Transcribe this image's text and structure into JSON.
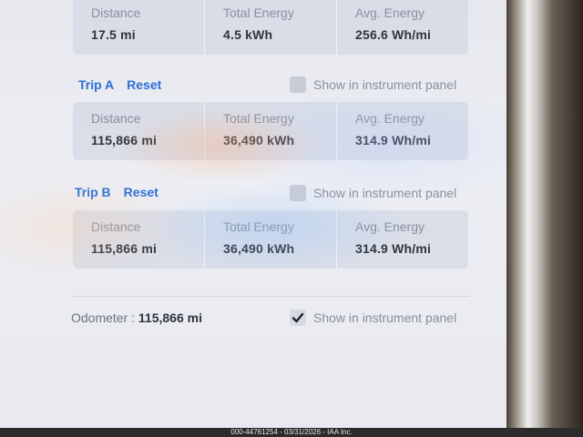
{
  "top_panel": {
    "cols": [
      {
        "label": "Distance",
        "value": "17.5 mi"
      },
      {
        "label": "Total Energy",
        "value": "4.5 kWh"
      },
      {
        "label": "Avg. Energy",
        "value": "256.6 Wh/mi"
      }
    ]
  },
  "trip_a": {
    "name": "Trip A",
    "reset": "Reset",
    "show_label": "Show in instrument panel",
    "cols": [
      {
        "label": "Distance",
        "value": "115,866 mi"
      },
      {
        "label": "Total Energy",
        "value": "36,490 kWh"
      },
      {
        "label": "Avg. Energy",
        "value": "314.9 Wh/mi"
      }
    ]
  },
  "trip_b": {
    "name": "Trip B",
    "reset": "Reset",
    "show_label": "Show in instrument panel",
    "cols": [
      {
        "label": "Distance",
        "value": "115,866 mi"
      },
      {
        "label": "Total Energy",
        "value": "36,490 kWh"
      },
      {
        "label": "Avg. Energy",
        "value": "314.9 Wh/mi"
      }
    ]
  },
  "odometer": {
    "label": "Odometer :",
    "value": "115,866 mi",
    "show_label": "Show in instrument panel",
    "checked": "true"
  },
  "footer": "000-44761254 - 03/31/2026 - IAA Inc.",
  "colors": {
    "accent": "#2d6fd6",
    "panel": "#d6dae6"
  },
  "icons": {
    "checkbox_checked": "checkmark-icon"
  }
}
